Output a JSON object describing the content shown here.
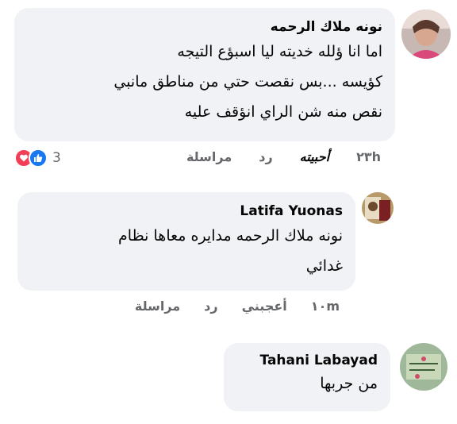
{
  "comments": [
    {
      "author": "نونه ملاك الرحمه",
      "lines": [
        "اما انا ؤلله خديته ليا اسبؤع التيجه",
        "كؤيسه ...بس نقصت حتي من مناطق مانبي",
        "نقص منه شن الراي انؤقف عليه"
      ],
      "time": "٢٣h",
      "like": "أحبيته",
      "reply": "رد",
      "message": "مراسلة",
      "reaction_count": "3",
      "reactions": [
        "love-icon",
        "like-icon"
      ]
    },
    {
      "author": "Latifa Yuonas",
      "lines": [
        "نونه ملاك الرحمه مدايره معاها نظام",
        "غدائي"
      ],
      "time": "١٠m",
      "like": "أعجبني",
      "reply": "رد",
      "message": "مراسلة"
    },
    {
      "author": "Tahani Labayad",
      "lines": [
        "من جربها"
      ]
    }
  ],
  "colors": {
    "bubble": "#f0f2f5",
    "meta": "#65676b",
    "like_blue": "#1877f2",
    "love_red": "#f33e58"
  }
}
